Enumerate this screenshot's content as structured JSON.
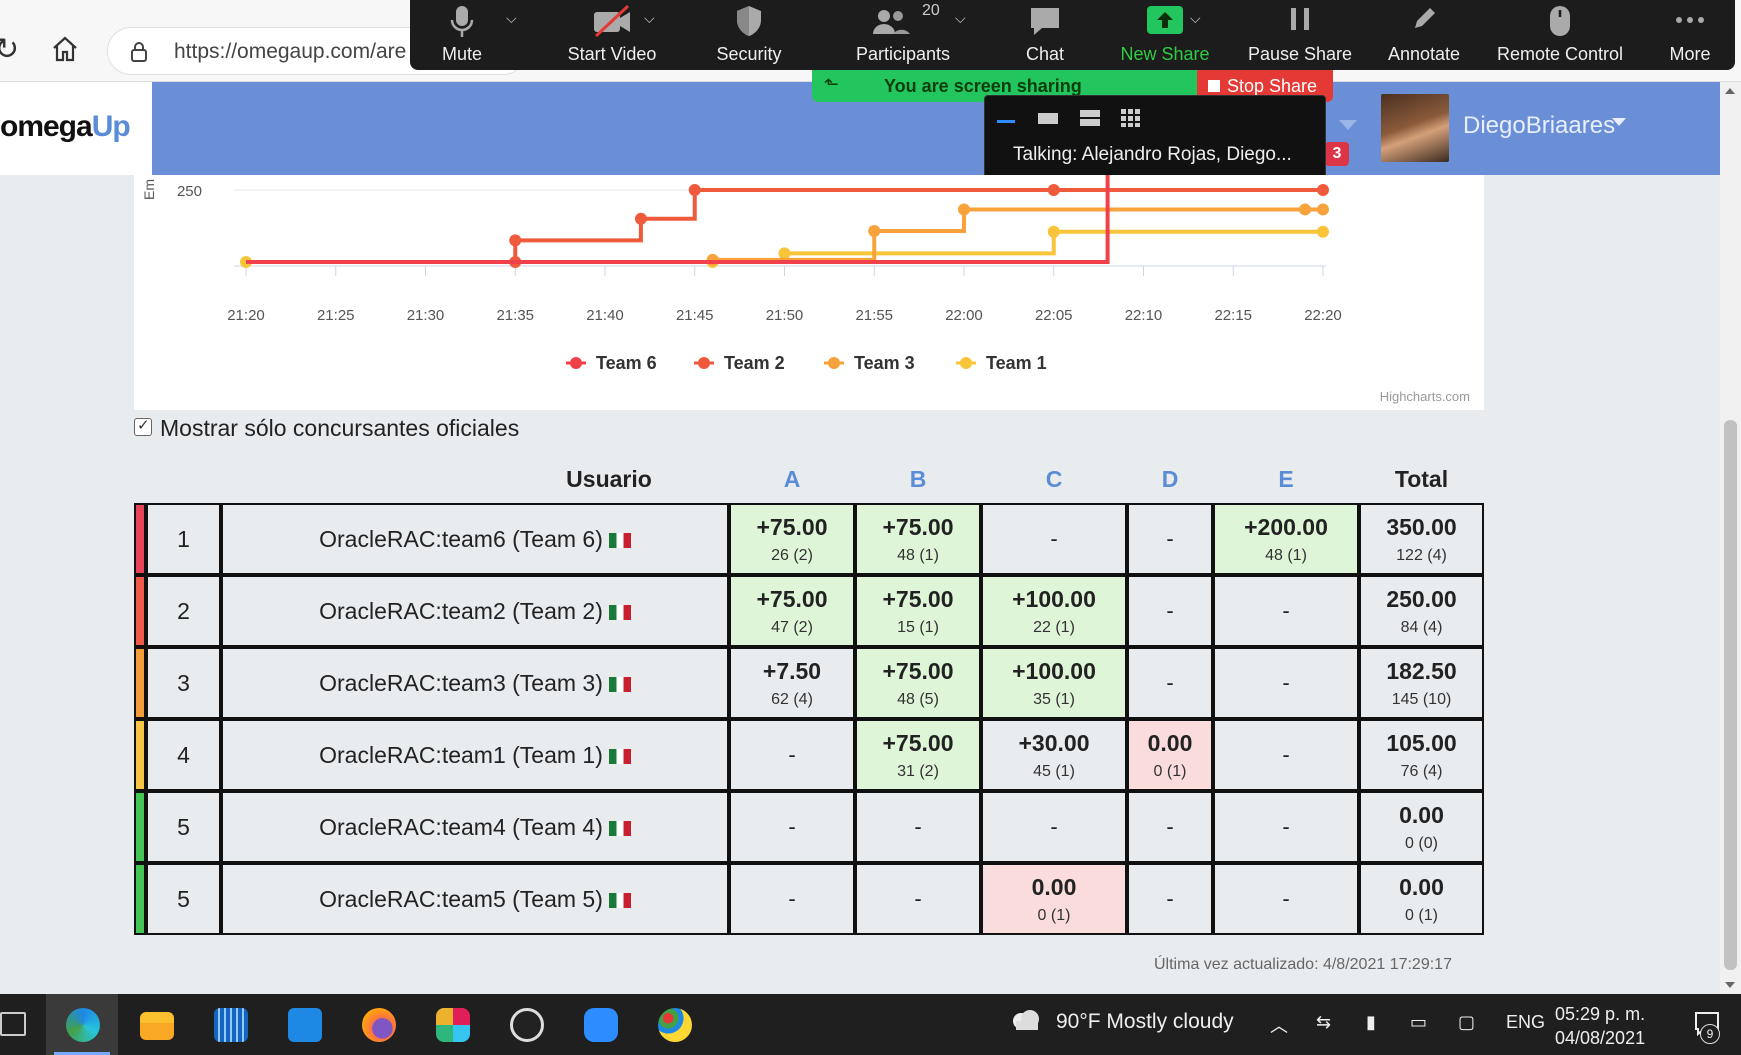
{
  "browser": {
    "url": "https://omegaup.com/are"
  },
  "zoom": {
    "toolbar": [
      {
        "label": "Mute",
        "icon": "microphone-icon"
      },
      {
        "label": "Start Video",
        "icon": "video-off-icon"
      },
      {
        "label": "Security",
        "icon": "shield-icon"
      },
      {
        "label": "Participants",
        "icon": "participants-icon",
        "count": "20"
      },
      {
        "label": "Chat",
        "icon": "chat-icon"
      },
      {
        "label": "New Share",
        "icon": "share-arrow-icon"
      },
      {
        "label": "Pause Share",
        "icon": "pause-icon"
      },
      {
        "label": "Annotate",
        "icon": "pencil-icon"
      },
      {
        "label": "Remote Control",
        "icon": "mouse-icon"
      },
      {
        "label": "More",
        "icon": "more-icon"
      }
    ],
    "sharing_banner": "You are screen sharing",
    "stop_share": "Stop Share",
    "talking": "Talking: Alejandro Rojas, Diego..."
  },
  "header": {
    "logo_part1": "omega",
    "logo_part2": "Up",
    "notification_count": "3",
    "username": "DiegoBriaares"
  },
  "chart_data": {
    "type": "line",
    "step": true,
    "ylabel": "Em",
    "ytick_visible": "250",
    "x_ticks": [
      "21:20",
      "21:25",
      "21:30",
      "21:35",
      "21:40",
      "21:45",
      "21:50",
      "21:55",
      "22:00",
      "22:05",
      "22:10",
      "22:15",
      "22:20"
    ],
    "series": [
      {
        "name": "Team 6",
        "color": "#f0414b",
        "points": [
          [
            "21:20",
            0
          ],
          [
            "22:08",
            350
          ],
          [
            "22:20",
            350
          ]
        ]
      },
      {
        "name": "Team 2",
        "color": "#f05a3c",
        "points": [
          [
            "21:20",
            0
          ],
          [
            "21:35",
            0
          ],
          [
            "21:35",
            75
          ],
          [
            "21:42",
            150
          ],
          [
            "21:45",
            250
          ],
          [
            "22:05",
            250
          ],
          [
            "22:20",
            250
          ]
        ]
      },
      {
        "name": "Team 3",
        "color": "#f7a23a",
        "points": [
          [
            "21:20",
            0
          ],
          [
            "21:46",
            7.5
          ],
          [
            "21:55",
            107.5
          ],
          [
            "22:00",
            182.5
          ],
          [
            "22:19",
            182.5
          ],
          [
            "22:20",
            182.5
          ]
        ]
      },
      {
        "name": "Team 1",
        "color": "#f8c53a",
        "points": [
          [
            "21:20",
            0
          ],
          [
            "21:46",
            0
          ],
          [
            "21:50",
            30
          ],
          [
            "22:05",
            105
          ],
          [
            "22:20",
            105
          ]
        ]
      }
    ],
    "legend_position": "bottom-center",
    "credit": "Highcharts.com"
  },
  "filters": {
    "official_only_label": "Mostrar sólo concursantes oficiales",
    "official_only_checked": true
  },
  "scoreboard": {
    "columns": {
      "user": "Usuario",
      "problems": [
        "A",
        "B",
        "C",
        "D",
        "E"
      ],
      "total": "Total"
    },
    "rows": [
      {
        "rank": "1",
        "user": "OracleRAC:team6 (Team 6)",
        "stripe": "#e8455a",
        "cells": [
          {
            "pts": "+75.00",
            "sub": "26 (2)",
            "state": "accepted"
          },
          {
            "pts": "+75.00",
            "sub": "48 (1)",
            "state": "accepted"
          },
          {
            "pts": "-",
            "sub": "",
            "state": "none"
          },
          {
            "pts": "-",
            "sub": "",
            "state": "none"
          },
          {
            "pts": "+200.00",
            "sub": "48 (1)",
            "state": "accepted"
          }
        ],
        "total": "350.00",
        "total_sub": "122 (4)"
      },
      {
        "rank": "2",
        "user": "OracleRAC:team2 (Team 2)",
        "stripe": "#ee5b4a",
        "cells": [
          {
            "pts": "+75.00",
            "sub": "47 (2)",
            "state": "accepted"
          },
          {
            "pts": "+75.00",
            "sub": "15 (1)",
            "state": "accepted"
          },
          {
            "pts": "+100.00",
            "sub": "22 (1)",
            "state": "accepted"
          },
          {
            "pts": "-",
            "sub": "",
            "state": "none"
          },
          {
            "pts": "-",
            "sub": "",
            "state": "none"
          }
        ],
        "total": "250.00",
        "total_sub": "84 (4)"
      },
      {
        "rank": "3",
        "user": "OracleRAC:team3 (Team 3)",
        "stripe": "#f39c3c",
        "cells": [
          {
            "pts": "+7.50",
            "sub": "62 (4)",
            "state": "none"
          },
          {
            "pts": "+75.00",
            "sub": "48 (5)",
            "state": "accepted"
          },
          {
            "pts": "+100.00",
            "sub": "35 (1)",
            "state": "accepted"
          },
          {
            "pts": "-",
            "sub": "",
            "state": "none"
          },
          {
            "pts": "-",
            "sub": "",
            "state": "none"
          }
        ],
        "total": "182.50",
        "total_sub": "145 (10)"
      },
      {
        "rank": "4",
        "user": "OracleRAC:team1 (Team 1)",
        "stripe": "#f7c443",
        "cells": [
          {
            "pts": "-",
            "sub": "",
            "state": "none"
          },
          {
            "pts": "+75.00",
            "sub": "31 (2)",
            "state": "accepted"
          },
          {
            "pts": "+30.00",
            "sub": "45 (1)",
            "state": "none"
          },
          {
            "pts": "0.00",
            "sub": "0 (1)",
            "state": "wrong"
          },
          {
            "pts": "-",
            "sub": "",
            "state": "none"
          }
        ],
        "total": "105.00",
        "total_sub": "76 (4)"
      },
      {
        "rank": "5",
        "user": "OracleRAC:team4 (Team 4)",
        "stripe": "#45c555",
        "cells": [
          {
            "pts": "-",
            "sub": "",
            "state": "none"
          },
          {
            "pts": "-",
            "sub": "",
            "state": "none"
          },
          {
            "pts": "-",
            "sub": "",
            "state": "none"
          },
          {
            "pts": "-",
            "sub": "",
            "state": "none"
          },
          {
            "pts": "-",
            "sub": "",
            "state": "none"
          }
        ],
        "total": "0.00",
        "total_sub": "0 (0)"
      },
      {
        "rank": "5",
        "user": "OracleRAC:team5 (Team 5)",
        "stripe": "#45c555",
        "cells": [
          {
            "pts": "-",
            "sub": "",
            "state": "none"
          },
          {
            "pts": "-",
            "sub": "",
            "state": "none"
          },
          {
            "pts": "0.00",
            "sub": "0 (1)",
            "state": "wrong"
          },
          {
            "pts": "-",
            "sub": "",
            "state": "none"
          },
          {
            "pts": "-",
            "sub": "",
            "state": "none"
          }
        ],
        "total": "0.00",
        "total_sub": "0 (1)"
      }
    ],
    "last_updated": "Última vez actualizado: 4/8/2021 17:29:17"
  },
  "taskbar": {
    "apps": [
      "task-view-icon",
      "edge-icon",
      "file-explorer-icon",
      "app-grid-icon",
      "whiteboard-icon",
      "firefox-icon",
      "slack-icon",
      "obs-icon",
      "zoom-icon",
      "paint-icon"
    ],
    "weather": "90°F  Mostly cloudy",
    "language": "ENG",
    "time": "05:29 p. m.",
    "date": "04/08/2021",
    "notifications": "9"
  }
}
